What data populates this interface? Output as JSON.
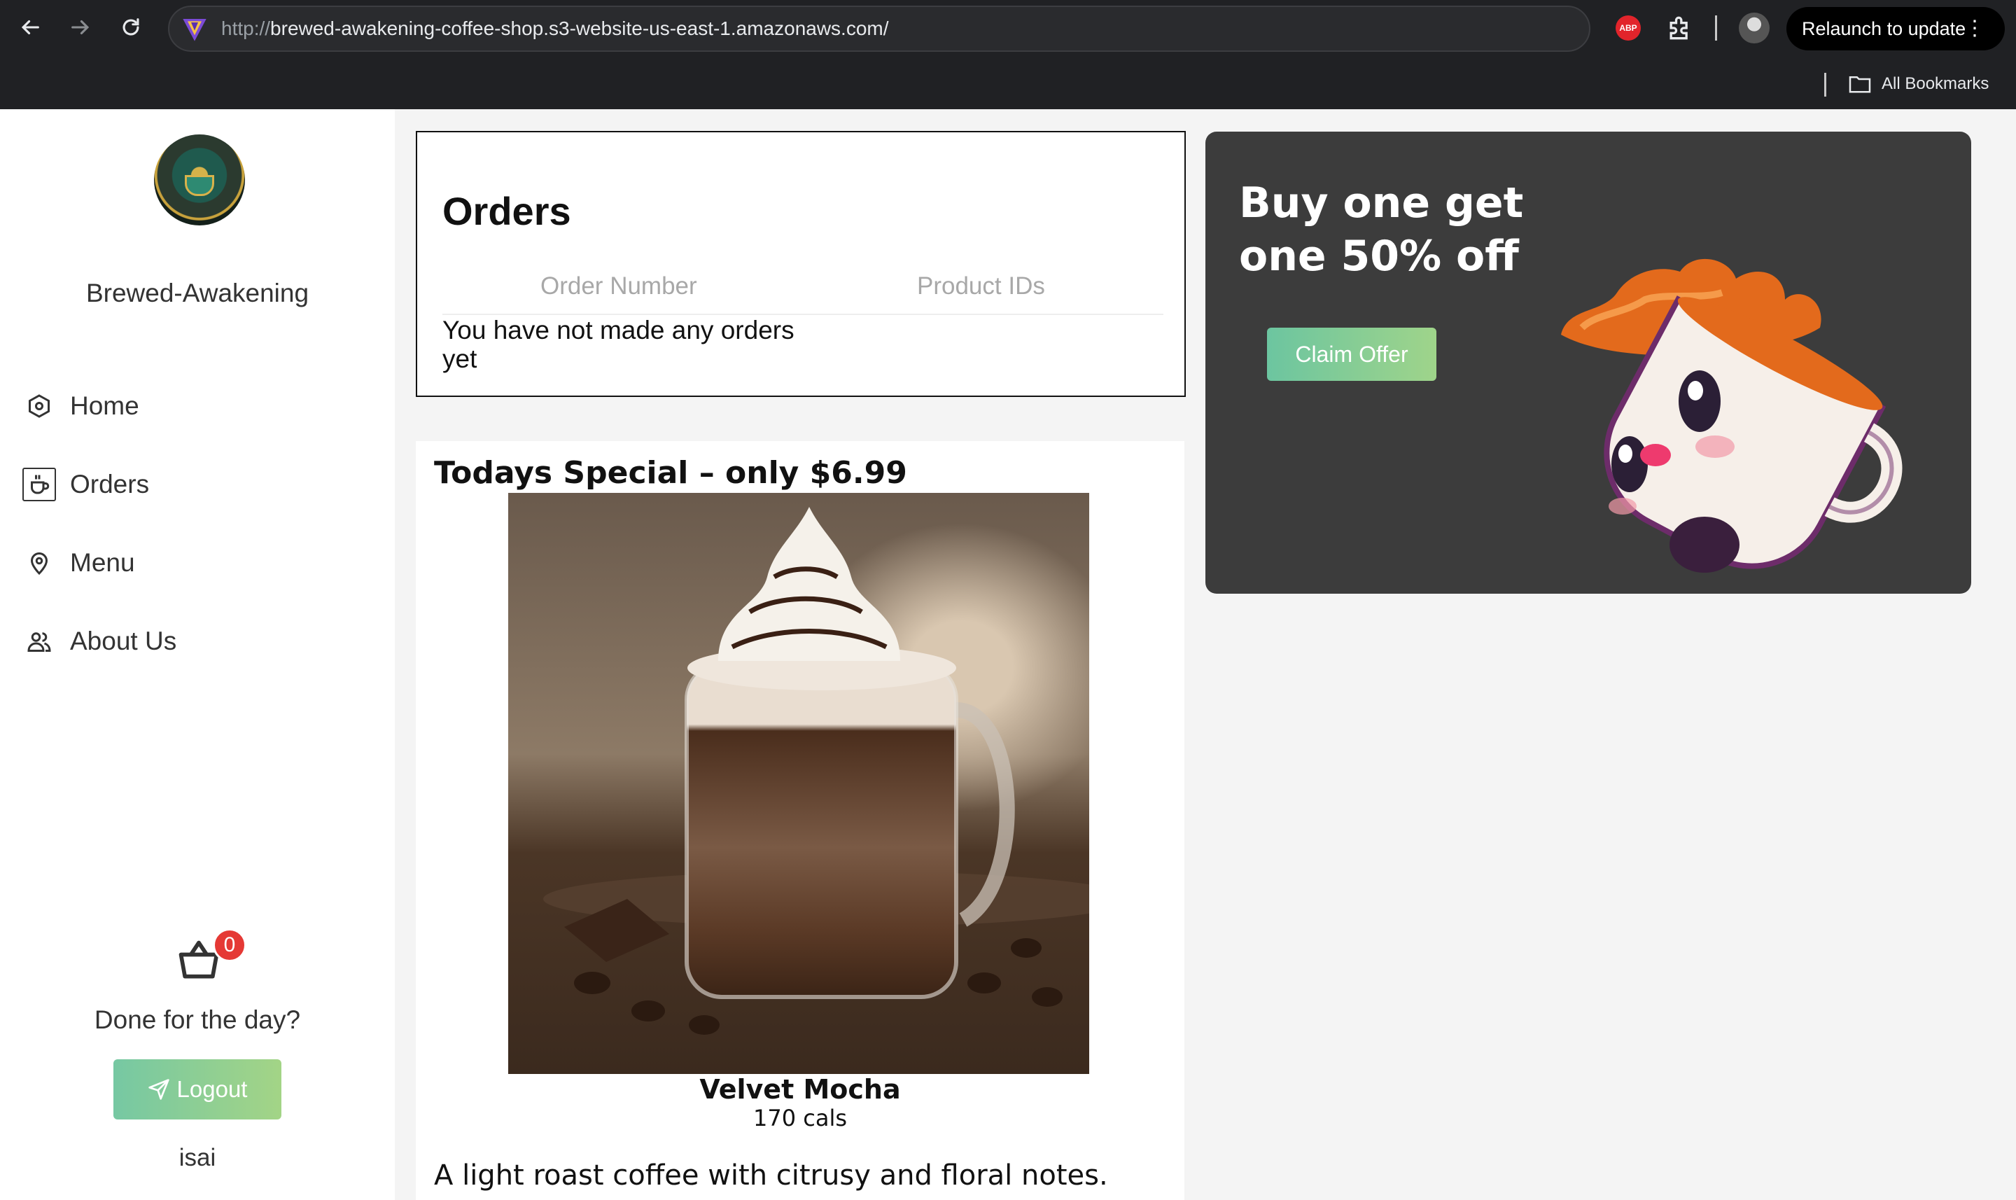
{
  "browser": {
    "url_scheme": "http://",
    "url_rest": "brewed-awakening-coffee-shop.s3-website-us-east-1.amazonaws.com/",
    "abp_label": "ABP",
    "relaunch_label": "Relaunch to update",
    "bookmarks_label": "All Bookmarks"
  },
  "sidebar": {
    "brand": "Brewed-Awakening",
    "items": [
      {
        "label": "Home",
        "icon": "hexagon-icon"
      },
      {
        "label": "Orders",
        "icon": "coffee-cup-icon"
      },
      {
        "label": "Menu",
        "icon": "location-pin-icon"
      },
      {
        "label": "About Us",
        "icon": "users-icon"
      }
    ],
    "cart_count": "0",
    "done_text": "Done for the day?",
    "logout_label": "Logout",
    "username": "isai"
  },
  "orders": {
    "title": "Orders",
    "columns": [
      "Order Number",
      "Product IDs"
    ],
    "empty_text": "You have not made any orders yet"
  },
  "special": {
    "title": "Todays Special – only $6.99",
    "product_name": "Velvet Mocha",
    "calories": "170 cals",
    "description": "A light roast coffee with citrusy and floral notes."
  },
  "promo": {
    "headline": "Buy one get one 50% off",
    "button_label": "Claim Offer"
  },
  "colors": {
    "chrome_bg": "#202124",
    "promo_bg": "#3c3c3c",
    "button_gradient_start": "#76c8a3",
    "button_gradient_end": "#a3d486",
    "badge_red": "#e53935"
  }
}
